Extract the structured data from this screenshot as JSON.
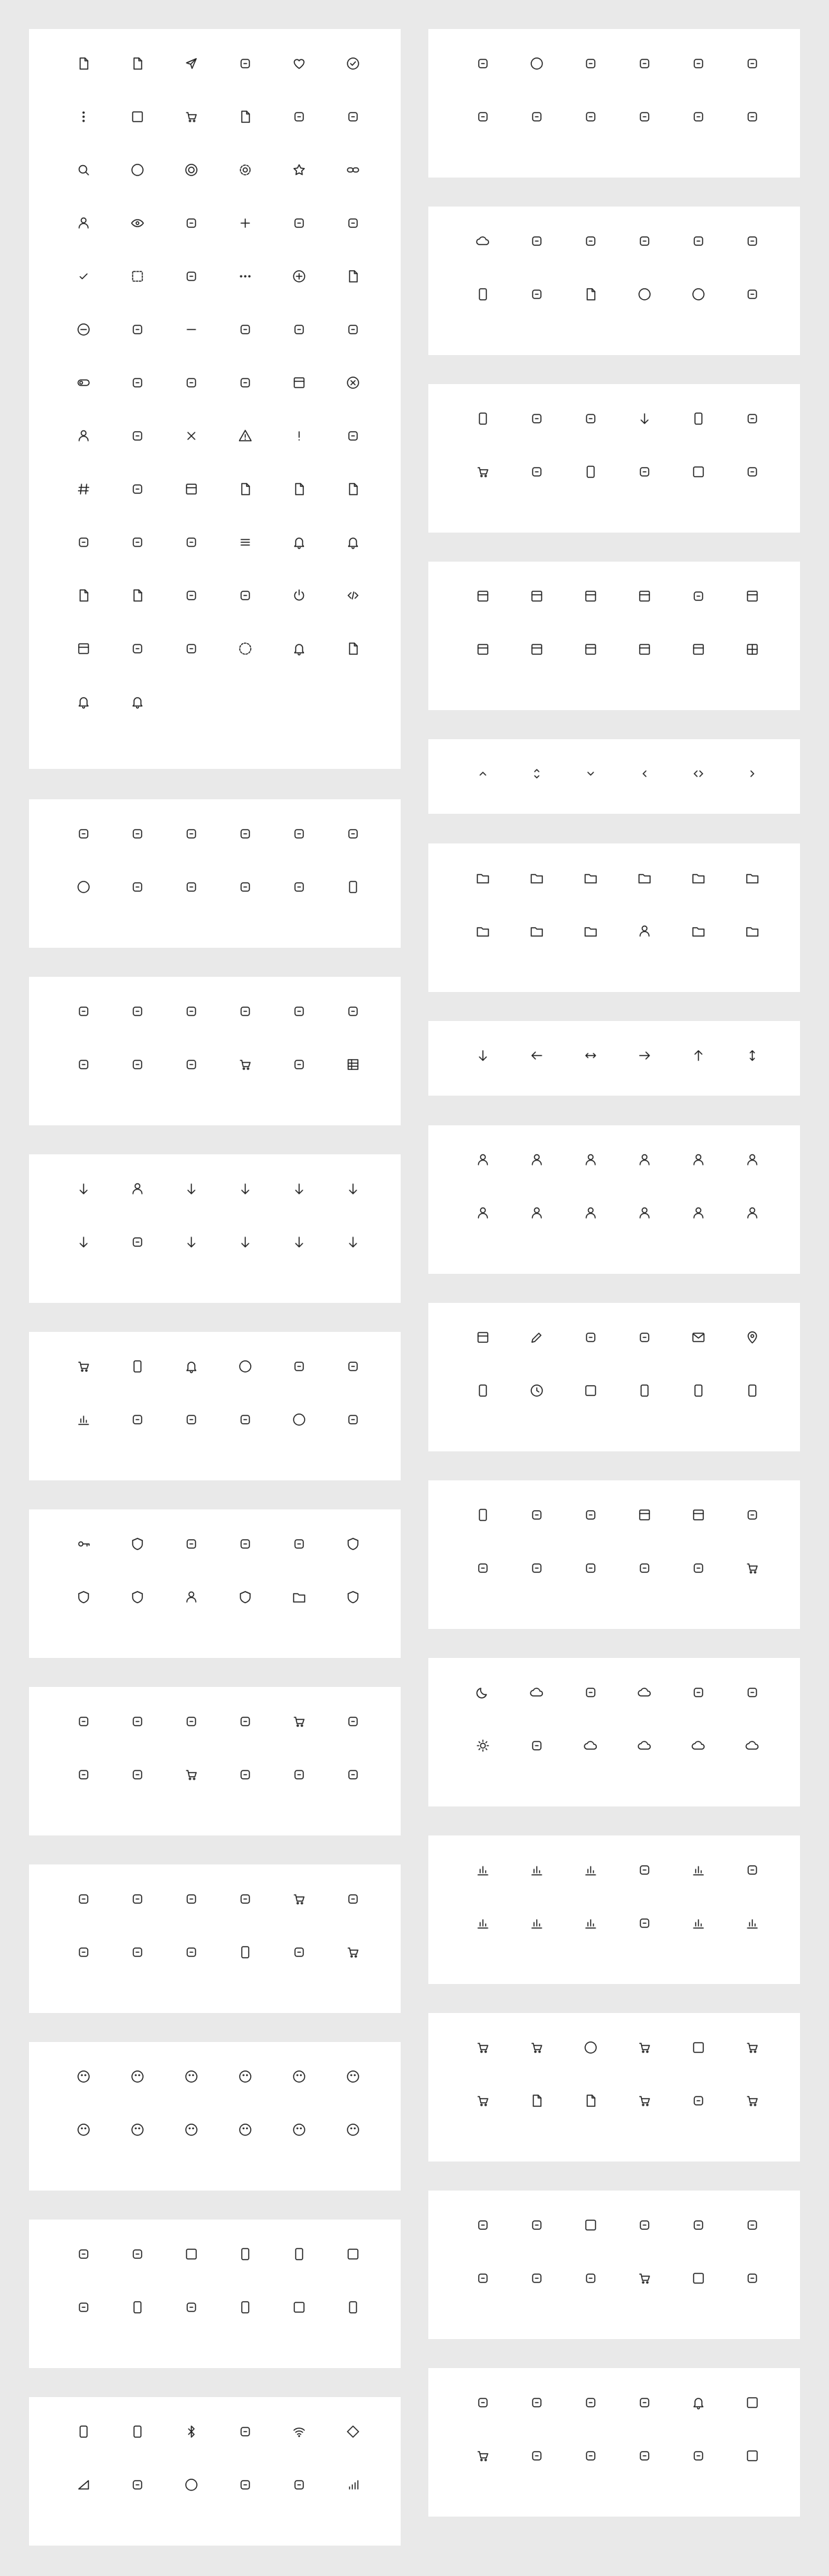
{
  "colors": {
    "background": "#e9e9e9",
    "card": "#ffffff",
    "icon_stroke": "#222222"
  },
  "left_cards": [
    {
      "id": "general",
      "icons": [
        "edit-note-icon",
        "file-icon",
        "send-icon",
        "book-open-icon",
        "heart-icon",
        "check-circle-icon",
        "more-vertical-icon",
        "square-icon",
        "checkbox-icon",
        "note-icon",
        "external-link-icon",
        "copy-icon",
        "search-icon",
        "circle-icon",
        "target-icon",
        "gear-icon",
        "star-icon",
        "link-icon",
        "user-icon",
        "eye-icon",
        "bookmark-add-icon",
        "plus-icon",
        "repeat-icon",
        "briefcase-icon",
        "check-icon",
        "dashed-square-icon",
        "loader-icon",
        "more-horizontal-icon",
        "plus-circle-icon",
        "file-plus-icon",
        "minus-circle-icon",
        "bookmark-minus-icon",
        "minus-icon",
        "repeat-alt-icon",
        "timer-icon",
        "archive-icon",
        "toggle-icon",
        "like-icon",
        "bookmark-icon",
        "bookmarks-icon",
        "calendar-icon",
        "x-circle-icon",
        "user-x-icon",
        "eye-closed-icon",
        "x-icon",
        "alert-triangle-icon",
        "exclamation-icon",
        "download-icon",
        "hash-icon",
        "calculator-icon",
        "sidebar-icon",
        "file-add-icon",
        "file-x-icon",
        "file-edit-icon",
        "loading-icon",
        "login-icon",
        "logout-icon",
        "menu-icon",
        "bell-icon",
        "bell-ring-icon",
        "file-check-icon",
        "document-icon",
        "pin-icon",
        "navigation-icon",
        "power-icon",
        "code-icon",
        "checklist-icon",
        "database-icon",
        "contact-icon",
        "dashed-circle-icon",
        "bell-plus-icon",
        "file-remove-icon",
        "bell-minus-icon",
        "bell-off-icon"
      ]
    },
    {
      "id": "home",
      "icons": [
        "bathtub-icon",
        "table-icon",
        "sofa-icon",
        "lamp-icon",
        "ceiling-lamp-icon",
        "switch-icon",
        "ring-icon",
        "floor-lamp-icon",
        "chair-icon",
        "radiator-icon",
        "stove-icon",
        "fridge-icon"
      ]
    },
    {
      "id": "text-editor",
      "icons": [
        "pen-icon",
        "text-icon",
        "text-size-icon",
        "align-center-icon",
        "paperclip-icon",
        "align-justify-icon",
        "paint-bucket-icon",
        "align-left-icon",
        "align-right-icon",
        "text-box-icon",
        "space-icon",
        "table-grid-icon"
      ]
    },
    {
      "id": "navigation",
      "icons": [
        "u-turn-icon",
        "person-walk-icon",
        "turn-left-icon",
        "fork-icon",
        "turn-left-alt-icon",
        "turn-right-icon",
        "merge-icon",
        "crossroad-icon",
        "turn-split-icon",
        "rotate-left-icon",
        "return-icon",
        "branch-icon"
      ]
    },
    {
      "id": "sport",
      "icons": [
        "basketball-icon",
        "bottle-icon",
        "dumbbell-icon",
        "baseball-icon",
        "whistle-icon",
        "footprints-icon",
        "podium-icon",
        "flag-icon",
        "rugby-icon",
        "weights-icon",
        "football-field-icon",
        "medal-icon"
      ]
    },
    {
      "id": "security",
      "icons": [
        "key-icon",
        "lock-icon",
        "siren-icon",
        "security-camera-icon",
        "fingerprint-icon",
        "safe-icon",
        "shield-badge-icon",
        "shield-check-icon",
        "shield-user-icon",
        "shield-icon",
        "folder-lock-icon",
        "shield-x-icon"
      ]
    },
    {
      "id": "brands",
      "icons": [
        "android-icon",
        "apple-icon",
        "behance-icon",
        "dribbble-icon",
        "dropbox-icon",
        "facebook-icon",
        "twitter-icon",
        "youtube-icon",
        "instagram-icon",
        "linkedin-icon",
        "figma-icon",
        "pinterest-icon"
      ]
    },
    {
      "id": "tools",
      "icons": [
        "paint-roller-icon",
        "ladder-icon",
        "drill-icon",
        "hammer-icon",
        "cart-trolley-icon",
        "cone-icon",
        "tape-measure-icon",
        "hand-mixer-icon",
        "ruler-icon",
        "battery-tool-icon",
        "plunger-icon",
        "toolbox-icon"
      ]
    },
    {
      "id": "emoji",
      "icons": [
        "sad-icon",
        "smile-icon",
        "happy-icon",
        "laugh-icon",
        "surprised-icon",
        "neutral-icon",
        "wink-icon",
        "confused-icon",
        "grin-icon",
        "meh-icon",
        "frown-icon",
        "tongue-icon"
      ]
    },
    {
      "id": "devices",
      "icons": [
        "camera-icon",
        "projector-icon",
        "monitor-icon",
        "headphones-icon",
        "tablet-icon",
        "keyboard-icon",
        "mouse-icon",
        "tablet-landscape-icon",
        "printer-icon",
        "watch-icon",
        "laptop-icon",
        "smartphone-icon"
      ]
    },
    {
      "id": "connectivity",
      "icons": [
        "battery-charging-icon",
        "battery-full-icon",
        "bluetooth-icon",
        "contrast-icon",
        "wifi-icon",
        "diamond-icon",
        "signal-low-icon",
        "signal-medium-icon",
        "radar-icon",
        "sun-dial-icon",
        "no-signal-icon",
        "bar-signal-icon"
      ]
    }
  ],
  "right_cards": [
    {
      "id": "medical",
      "icons": [
        "molecule-icon",
        "syringe-icon",
        "heart-pulse-icon",
        "stethoscope-icon",
        "hospital-icon",
        "flask-icon",
        "first-aid-icon",
        "test-tube-icon",
        "virus-icon",
        "pill-icon",
        "ribbon-icon",
        "injection-icon"
      ]
    },
    {
      "id": "media",
      "icons": [
        "rewind-icon",
        "pause-bars-icon",
        "speaker-icon",
        "fast-forward-icon",
        "volume-down-icon",
        "volume-up-icon",
        "microphone-icon",
        "sliders-icon",
        "music-note-icon",
        "play-circle-icon",
        "stop-circle-icon",
        "volume-icon"
      ]
    },
    {
      "id": "food",
      "icons": [
        "cup-icon",
        "bowl-icon",
        "music-eighth-icon",
        "fork-icon-alt",
        "fridge-alt-icon",
        "knife-icon",
        "shopping-bag-icon",
        "pepper-icon",
        "milk-icon",
        "lollipop-icon",
        "wallet-card-icon",
        "plate-icon"
      ]
    },
    {
      "id": "layout",
      "icons": [
        "layout-list-icon",
        "layout-sidebar-icon",
        "layout-bottom-icon",
        "layout-top-icon",
        "quote-icon",
        "layout-grid-icon",
        "newspaper-icon",
        "list-checks-icon",
        "list-todo-icon",
        "layout-panel-icon",
        "rows-icon",
        "grid-icon"
      ]
    },
    {
      "id": "chevrons",
      "icons": [
        "chevron-up-icon",
        "chevron-up-down-icon",
        "chevron-down-icon",
        "chevron-left-icon",
        "chevrons-horizontal-icon",
        "chevron-right-icon"
      ]
    },
    {
      "id": "folders",
      "icons": [
        "folder-plus-icon",
        "folder-up-icon",
        "folder-down-icon",
        "folder-edit-icon",
        "folder-star-icon",
        "folder-heart-icon",
        "folder-minus-icon",
        "folder-settings-icon",
        "folder-icon",
        "folder-user-icon",
        "folder-lock-icon-alt",
        "folder-music-icon"
      ]
    },
    {
      "id": "arrows",
      "icons": [
        "arrow-down-icon",
        "arrow-left-icon",
        "arrow-left-right-icon",
        "arrow-right-icon",
        "arrow-up-icon",
        "arrow-up-down-icon"
      ]
    },
    {
      "id": "users",
      "icons": [
        "user-add-icon",
        "user-check-icon",
        "user-remove-icon",
        "user-settings-icon",
        "user-clock-icon",
        "user-x-alt-icon",
        "user-plus-alt-icon",
        "user-minus-alt-icon",
        "user-search-icon",
        "user-star-icon",
        "user-lock-icon",
        "user-heart-icon"
      ]
    },
    {
      "id": "communication",
      "icons": [
        "browser-icon",
        "pencil-icon",
        "compose-icon",
        "chat-bubbles-icon",
        "mail-icon",
        "map-pin-icon",
        "phone-call-icon",
        "clock-icon",
        "message-square-icon",
        "mobile-icon",
        "phone-icon",
        "telephone-icon"
      ]
    },
    {
      "id": "travel",
      "icons": [
        "bottle-spray-icon",
        "bow-tie-icon",
        "sun-lamp-icon",
        "calendar-alt-icon",
        "presentation-icon",
        "bank-icon",
        "rocket-icon",
        "mountain-icon",
        "tree-icon",
        "tent-icon",
        "house-icon",
        "store-icon"
      ]
    },
    {
      "id": "weather",
      "icons": [
        "moon-icon",
        "snowflake-icon",
        "lightning-icon",
        "cloud-icon",
        "cookie-icon",
        "droplets-icon",
        "sun-icon",
        "thermometer-icon",
        "umbrella-icon",
        "wind-icon",
        "cloud-upload-icon",
        "cloud-rain-icon"
      ]
    },
    {
      "id": "charts",
      "icons": [
        "bar-chart-icon",
        "line-chart-icon",
        "scatter-chart-icon",
        "spark-icon",
        "donut-chart-icon",
        "nodes-icon",
        "gantt-icon",
        "trend-chart-icon",
        "gauge-icon",
        "network-icon",
        "pie-chart-icon",
        "funnel-icon"
      ]
    },
    {
      "id": "commerce",
      "icons": [
        "truck-icon",
        "gift-icon",
        "circle-outline-icon",
        "basket-icon",
        "credit-card-icon",
        "cart-icon",
        "shop-icon",
        "receipt-icon",
        "banknote-icon",
        "box-icon",
        "scale-icon",
        "tag-icon"
      ]
    },
    {
      "id": "finance",
      "icons": [
        "bath-icon",
        "qr-code-icon",
        "grid-dots-icon",
        "money-stack-icon",
        "building-icon",
        "dashboard-icon",
        "factory-icon",
        "ai-chip-icon",
        "dollar-sign-icon",
        "package-icon",
        "wallet-icon",
        "handshake-icon"
      ]
    },
    {
      "id": "misc",
      "icons": [
        "percent-icon",
        "running-icon",
        "server-icon",
        "scan-icon",
        "bell-outline-icon",
        "cardholder-icon",
        "store-front-icon",
        "bonsai-icon",
        "hanger-icon",
        "signboard-icon",
        "shirt-icon",
        "wallet-alt-icon"
      ]
    }
  ]
}
